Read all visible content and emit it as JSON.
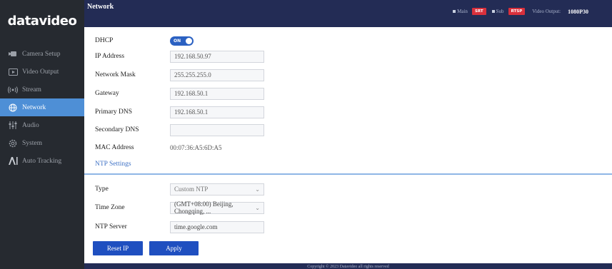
{
  "brand": {
    "logo_text": "datavideo"
  },
  "sidebar": {
    "items": [
      {
        "label": "Camera Setup",
        "icon": "camera-icon",
        "active": false
      },
      {
        "label": "Video Output",
        "icon": "play-icon",
        "active": false
      },
      {
        "label": "Stream",
        "icon": "stream-icon",
        "active": false
      },
      {
        "label": "Network",
        "icon": "globe-icon",
        "active": true
      },
      {
        "label": "Audio",
        "icon": "audio-icon",
        "active": false
      },
      {
        "label": "System",
        "icon": "gear-icon",
        "active": false
      },
      {
        "label": "Auto Tracking",
        "icon": "ai-icon",
        "active": false
      }
    ]
  },
  "header": {
    "title": "Network",
    "main_label": "Main",
    "main_badge": "SRT",
    "sub_label": "Sub",
    "sub_badge": "RTSP",
    "video_output_label": "Video Output:",
    "video_output_value": "1080P30"
  },
  "form": {
    "dhcp": {
      "label": "DHCP",
      "toggle_text": "ON",
      "on": true
    },
    "ip_address": {
      "label": "IP Address",
      "value": "192.168.50.97"
    },
    "network_mask": {
      "label": "Network Mask",
      "value": "255.255.255.0"
    },
    "gateway": {
      "label": "Gateway",
      "value": "192.168.50.1"
    },
    "primary_dns": {
      "label": "Primary DNS",
      "value": "192.168.50.1"
    },
    "secondary_dns": {
      "label": "Secondary DNS",
      "value": ""
    },
    "mac_address": {
      "label": "MAC Address",
      "value": "00:07:36:A5:6D:A5"
    }
  },
  "ntp": {
    "section_title": "NTP Settings",
    "type": {
      "label": "Type",
      "value": "Custom NTP"
    },
    "time_zone": {
      "label": "Time Zone",
      "value": "(GMT+08:00) Beijing, Chongqing, ..."
    },
    "ntp_server": {
      "label": "NTP Server",
      "value": "time.google.com"
    }
  },
  "buttons": {
    "reset_ip": "Reset IP",
    "apply": "Apply"
  },
  "footer": {
    "text": "Copyright © 2023 Datavideo all rights reserved"
  },
  "colors": {
    "sidebar_bg": "#262a30",
    "header_bg": "#232c55",
    "accent": "#4e8fd6",
    "button": "#1f4fc0",
    "badge": "#d9303c"
  }
}
